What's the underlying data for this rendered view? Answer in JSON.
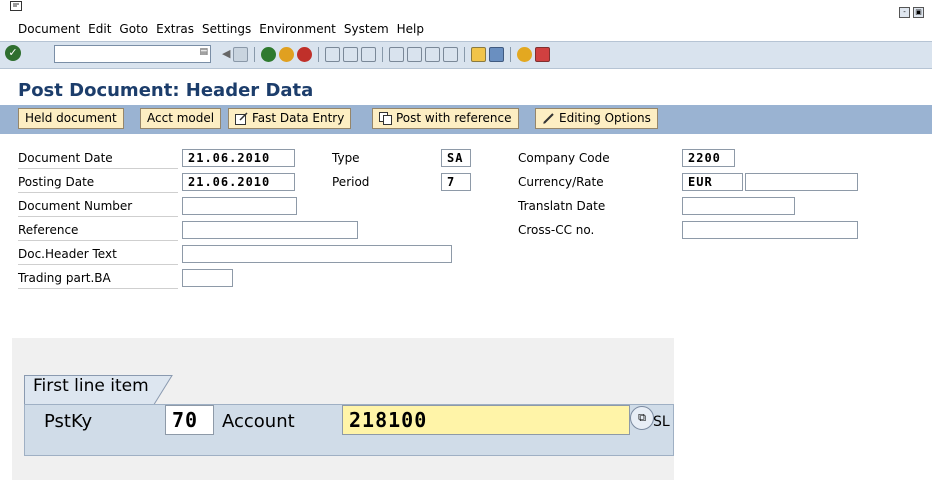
{
  "menu": [
    "Document",
    "Edit",
    "Goto",
    "Extras",
    "Settings",
    "Environment",
    "System",
    "Help"
  ],
  "page_title": "Post Document: Header Data",
  "app_toolbar": {
    "held_document": "Held document",
    "acct_model": "Acct model",
    "fast_data_entry": "Fast Data Entry",
    "post_with_reference": "Post with reference",
    "editing_options": "Editing Options"
  },
  "form": {
    "document_date": {
      "label": "Document Date",
      "value": "21.06.2010"
    },
    "posting_date": {
      "label": "Posting Date",
      "value": "21.06.2010"
    },
    "document_number": {
      "label": "Document Number",
      "value": ""
    },
    "reference": {
      "label": "Reference",
      "value": ""
    },
    "doc_header_text": {
      "label": "Doc.Header Text",
      "value": ""
    },
    "trading_part_ba": {
      "label": "Trading part.BA",
      "value": ""
    },
    "type": {
      "label": "Type",
      "value": "SA"
    },
    "period": {
      "label": "Period",
      "value": "7"
    },
    "company_code": {
      "label": "Company Code",
      "value": "2200"
    },
    "currency_rate": {
      "label": "Currency/Rate",
      "value": "EUR",
      "rate": ""
    },
    "translatn_date": {
      "label": "Translatn Date",
      "value": ""
    },
    "cross_cc_no": {
      "label": "Cross-CC no.",
      "value": ""
    }
  },
  "first_line_item": {
    "tab_label": "First line item",
    "pstky_label": "PstKy",
    "pstky_value": "70",
    "account_label": "Account",
    "account_value": "218100",
    "suffix": "SL"
  },
  "colors": {
    "title": "#1c3d6b",
    "app_toolbar_bg": "#9ab3d2",
    "button_bg": "#fdeec3",
    "account_field_bg": "#fff4a8"
  }
}
